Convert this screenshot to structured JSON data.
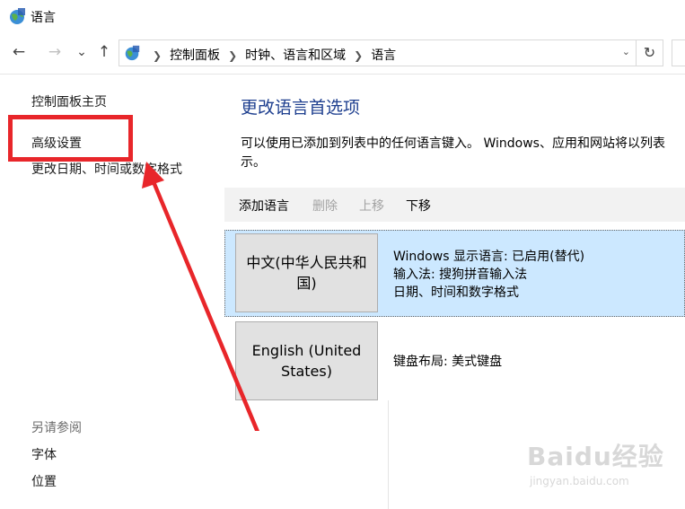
{
  "window": {
    "title": "语言"
  },
  "nav": {
    "back_label": "←",
    "forward_label": "→",
    "recent_label": "⌄",
    "up_label": "↑",
    "refresh_label": "↻",
    "breadcrumbs": [
      "控制面板",
      "时钟、语言和区域",
      "语言"
    ]
  },
  "sidebar": {
    "items": [
      {
        "label": "控制面板主页"
      },
      {
        "label": "高级设置"
      },
      {
        "label": "更改日期、时间或数字格式"
      }
    ],
    "see_also_title": "另请参阅",
    "see_also": [
      {
        "label": "字体"
      },
      {
        "label": "位置"
      }
    ]
  },
  "main": {
    "heading": "更改语言首选项",
    "description_line1": "可以使用已添加到列表中的任何语言键入。 Windows、应用和网站将以列表",
    "description_line2": "示。",
    "toolbar": {
      "add_label": "添加语言",
      "delete_label": "删除",
      "up_label": "上移",
      "down_label": "下移"
    },
    "languages": [
      {
        "name": "中文(中华人民共和国)",
        "info": [
          "Windows 显示语言: 已启用(替代)",
          "输入法: 搜狗拼音输入法",
          "日期、时间和数字格式"
        ],
        "selected": true
      },
      {
        "name": "English (United States)",
        "info": [
          "键盘布局: 美式键盘"
        ],
        "selected": false
      }
    ]
  },
  "annotation": {
    "color": "#e8262a"
  },
  "watermark": {
    "text": "Baidu经验",
    "sub": "jingyan.baidu.com"
  }
}
